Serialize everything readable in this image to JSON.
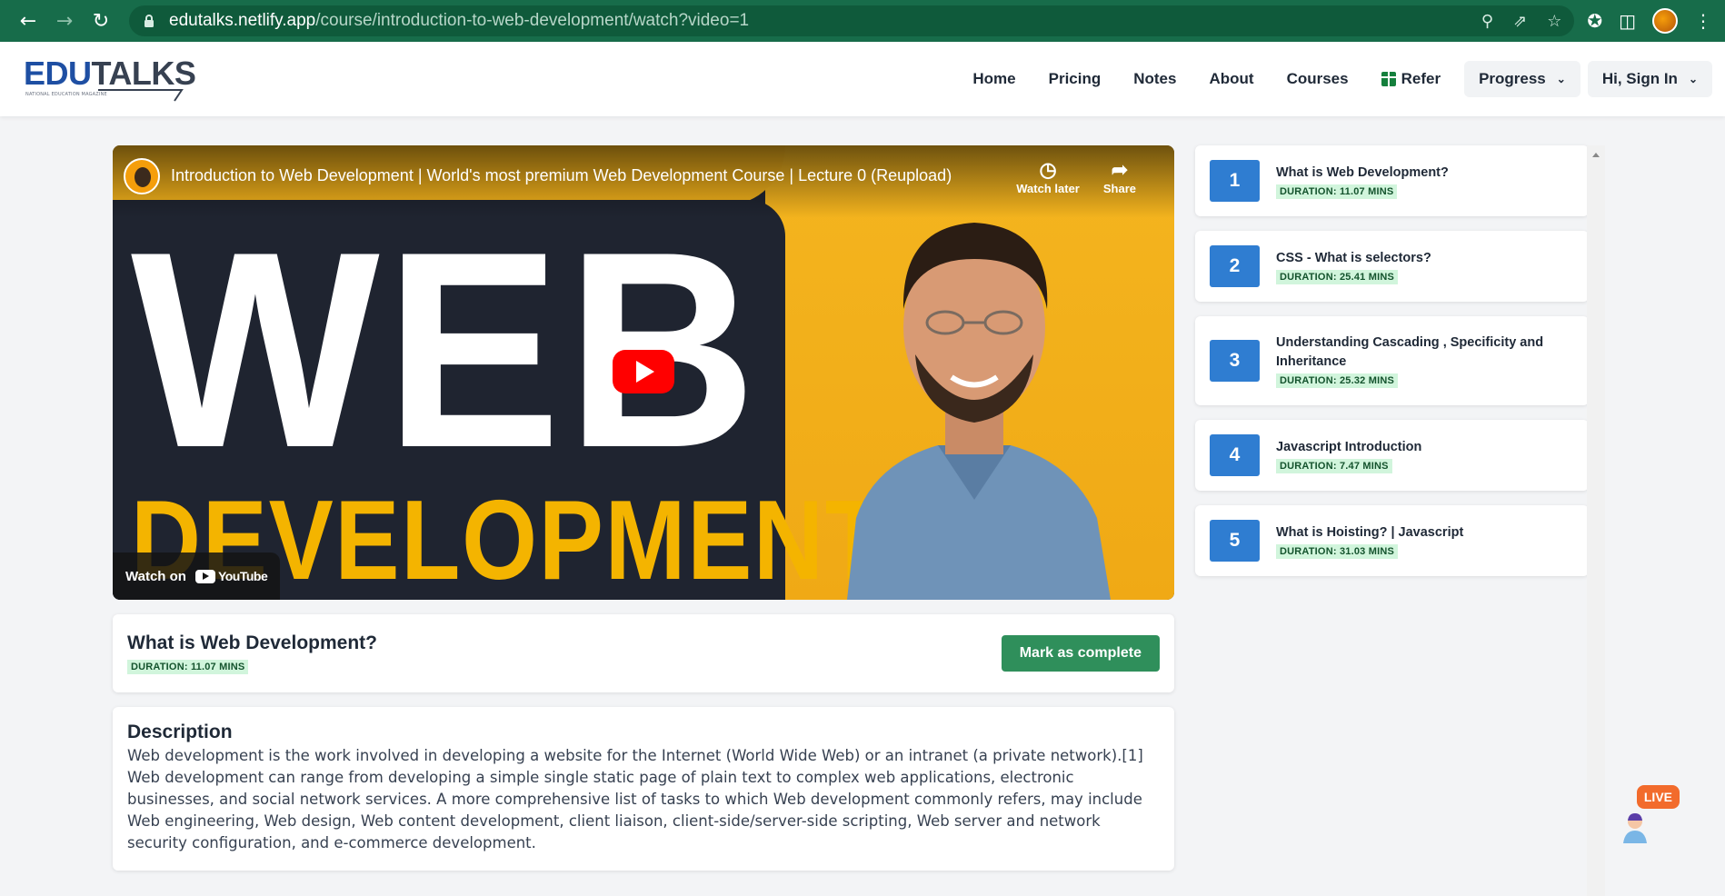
{
  "browser": {
    "url_host": "edutalks.netlify.app",
    "url_path": "/course/introduction-to-web-development/watch?video=1"
  },
  "header": {
    "logo_part1": "EDU",
    "logo_part2": "TALKS",
    "logo_tagline": "NATIONAL EDUCATION MAGAZINE",
    "nav": [
      "Home",
      "Pricing",
      "Notes",
      "About",
      "Courses"
    ],
    "refer_label": "Refer",
    "progress_label": "Progress",
    "signin_label": "Hi, Sign In"
  },
  "video": {
    "title": "Introduction to Web Development | World's most premium Web Development Course | Lecture 0 (Reupload)",
    "thumb_line1": "WEB",
    "thumb_line2": "DEVELOPMENT",
    "watch_later": "Watch later",
    "share": "Share",
    "watch_on": "Watch on",
    "youtube": "YouTube"
  },
  "current_lesson": {
    "title": "What is Web Development?",
    "duration": "DURATION:  11.07 MINS",
    "complete_label": "Mark as complete"
  },
  "description": {
    "heading": "Description",
    "text": "Web development is the work involved in developing a website for the Internet (World Wide Web) or an intranet (a private network).[1] Web development can range from developing a simple single static page of plain text to complex web applications, electronic businesses, and social network services. A more comprehensive list of tasks to which Web development commonly refers, may include Web engineering, Web design, Web content development, client liaison, client-side/server-side scripting, Web server and network security configuration, and e-commerce development."
  },
  "playlist": [
    {
      "num": "1",
      "title": "What is Web Development?",
      "duration": "DURATION:  11.07 MINS"
    },
    {
      "num": "2",
      "title": "CSS - What is selectors?",
      "duration": "DURATION:  25.41 MINS"
    },
    {
      "num": "3",
      "title": "Understanding Cascading , Specificity and Inheritance",
      "duration": "DURATION:  25.32 MINS"
    },
    {
      "num": "4",
      "title": "Javascript Introduction",
      "duration": "DURATION:  7.47 MINS"
    },
    {
      "num": "5",
      "title": "What is Hoisting? | Javascript",
      "duration": "DURATION:  31.03 MINS"
    }
  ],
  "live_badge": "LIVE",
  "colors": {
    "chrome": "#176c4a",
    "accent_blue": "#2f7dd1",
    "complete_green": "#2f8f5b",
    "duration_bg": "#d1f5dc"
  }
}
